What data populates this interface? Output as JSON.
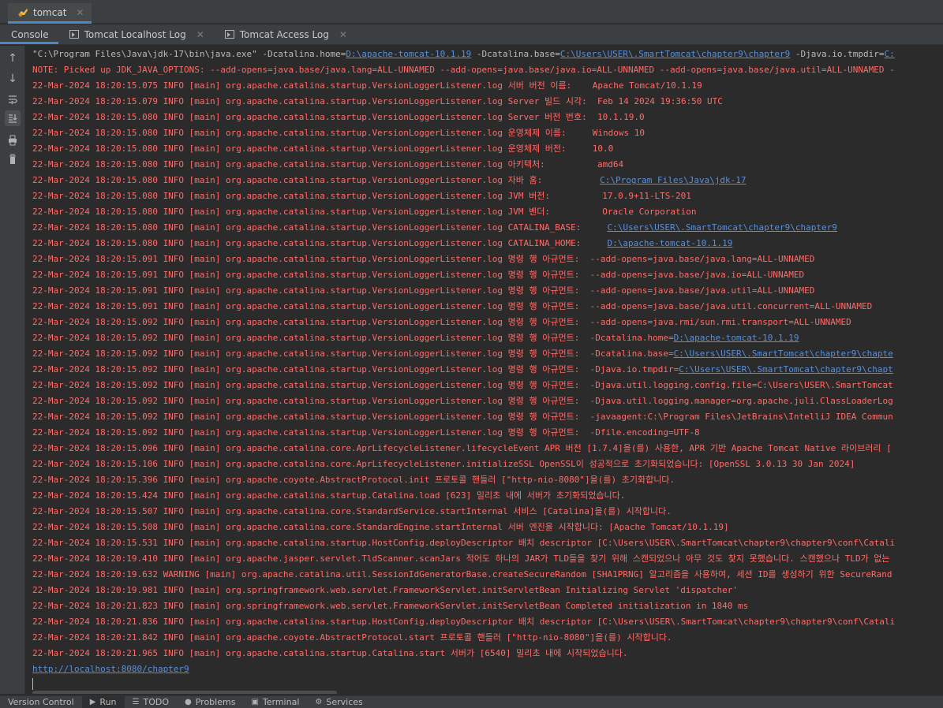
{
  "run_tab": {
    "label": "tomcat"
  },
  "sub_tabs": [
    {
      "label": "Console"
    },
    {
      "label": "Tomcat Localhost Log"
    },
    {
      "label": "Tomcat Access Log"
    }
  ],
  "console": {
    "command": {
      "pre": "\"C:\\Program Files\\Java\\jdk-17\\bin\\java.exe\" -Dcatalina.home=",
      "home": "D:\\apache-tomcat-10.1.19",
      "mid": " -Dcatalina.base=",
      "base": "C:\\Users\\USER\\.SmartTomcat\\chapter9\\chapter9",
      "post": " -Djava.io.tmpdir=",
      "tmp": "C:"
    },
    "lines": [
      "NOTE: Picked up JDK_JAVA_OPTIONS: --add-opens=java.base/java.lang=ALL-UNNAMED --add-opens=java.base/java.io=ALL-UNNAMED --add-opens=java.base/java.util=ALL-UNNAMED -",
      "22-Mar-2024 18:20:15.075 INFO [main] org.apache.catalina.startup.VersionLoggerListener.log 서버 버전 이름:    Apache Tomcat/10.1.19",
      "22-Mar-2024 18:20:15.079 INFO [main] org.apache.catalina.startup.VersionLoggerListener.log Server 빌드 시각:  Feb 14 2024 19:36:50 UTC",
      "22-Mar-2024 18:20:15.080 INFO [main] org.apache.catalina.startup.VersionLoggerListener.log Server 버전 번호:  10.1.19.0",
      "22-Mar-2024 18:20:15.080 INFO [main] org.apache.catalina.startup.VersionLoggerListener.log 운영체제 이름:     Windows 10",
      "22-Mar-2024 18:20:15.080 INFO [main] org.apache.catalina.startup.VersionLoggerListener.log 운영체제 버전:     10.0",
      "22-Mar-2024 18:20:15.080 INFO [main] org.apache.catalina.startup.VersionLoggerListener.log 아키텍처:          amd64"
    ],
    "java_home": {
      "pre": "22-Mar-2024 18:20:15.080 INFO [main] org.apache.catalina.startup.VersionLoggerListener.log 자바 홈:           ",
      "link": "C:\\Program Files\\Java\\jdk-17"
    },
    "lines2": [
      "22-Mar-2024 18:20:15.080 INFO [main] org.apache.catalina.startup.VersionLoggerListener.log JVM 버전:          17.0.9+11-LTS-201",
      "22-Mar-2024 18:20:15.080 INFO [main] org.apache.catalina.startup.VersionLoggerListener.log JVM 벤더:          Oracle Corporation"
    ],
    "cat_base": {
      "pre": "22-Mar-2024 18:20:15.080 INFO [main] org.apache.catalina.startup.VersionLoggerListener.log CATALINA_BASE:     ",
      "link": "C:\\Users\\USER\\.SmartTomcat\\chapter9\\chapter9"
    },
    "cat_home": {
      "pre": "22-Mar-2024 18:20:15.080 INFO [main] org.apache.catalina.startup.VersionLoggerListener.log CATALINA_HOME:     ",
      "link": "D:\\apache-tomcat-10.1.19"
    },
    "lines3": [
      "22-Mar-2024 18:20:15.091 INFO [main] org.apache.catalina.startup.VersionLoggerListener.log 명령 행 아규먼트:  --add-opens=java.base/java.lang=ALL-UNNAMED",
      "22-Mar-2024 18:20:15.091 INFO [main] org.apache.catalina.startup.VersionLoggerListener.log 명령 행 아규먼트:  --add-opens=java.base/java.io=ALL-UNNAMED",
      "22-Mar-2024 18:20:15.091 INFO [main] org.apache.catalina.startup.VersionLoggerListener.log 명령 행 아규먼트:  --add-opens=java.base/java.util=ALL-UNNAMED",
      "22-Mar-2024 18:20:15.091 INFO [main] org.apache.catalina.startup.VersionLoggerListener.log 명령 행 아규먼트:  --add-opens=java.base/java.util.concurrent=ALL-UNNAMED",
      "22-Mar-2024 18:20:15.092 INFO [main] org.apache.catalina.startup.VersionLoggerListener.log 명령 행 아규먼트:  --add-opens=java.rmi/sun.rmi.transport=ALL-UNNAMED"
    ],
    "arg_home": {
      "pre": "22-Mar-2024 18:20:15.092 INFO [main] org.apache.catalina.startup.VersionLoggerListener.log 명령 행 아규먼트:  -Dcatalina.home=",
      "link": "D:\\apache-tomcat-10.1.19"
    },
    "arg_base": {
      "pre": "22-Mar-2024 18:20:15.092 INFO [main] org.apache.catalina.startup.VersionLoggerListener.log 명령 행 아규먼트:  -Dcatalina.base=",
      "link": "C:\\Users\\USER\\.SmartTomcat\\chapter9\\chapte"
    },
    "arg_tmp": {
      "pre": "22-Mar-2024 18:20:15.092 INFO [main] org.apache.catalina.startup.VersionLoggerListener.log 명령 행 아규먼트:  -Djava.io.tmpdir=",
      "link": "C:\\Users\\USER\\.SmartTomcat\\chapter9\\chapt"
    },
    "lines4": [
      "22-Mar-2024 18:20:15.092 INFO [main] org.apache.catalina.startup.VersionLoggerListener.log 명령 행 아규먼트:  -Djava.util.logging.config.file=C:\\Users\\USER\\.SmartTomcat",
      "22-Mar-2024 18:20:15.092 INFO [main] org.apache.catalina.startup.VersionLoggerListener.log 명령 행 아규먼트:  -Djava.util.logging.manager=org.apache.juli.ClassLoaderLog",
      "22-Mar-2024 18:20:15.092 INFO [main] org.apache.catalina.startup.VersionLoggerListener.log 명령 행 아규먼트:  -javaagent:C:\\Program Files\\JetBrains\\IntelliJ IDEA Commun",
      "22-Mar-2024 18:20:15.092 INFO [main] org.apache.catalina.startup.VersionLoggerListener.log 명령 행 아규먼트:  -Dfile.encoding=UTF-8",
      "22-Mar-2024 18:20:15.096 INFO [main] org.apache.catalina.core.AprLifecycleListener.lifecycleEvent APR 버전 [1.7.4]을(를) 사용한, APR 기반 Apache Tomcat Native 라이브러리 [",
      "22-Mar-2024 18:20:15.106 INFO [main] org.apache.catalina.core.AprLifecycleListener.initializeSSL OpenSSL이 성공적으로 초기화되었습니다: [OpenSSL 3.0.13 30 Jan 2024]",
      "22-Mar-2024 18:20:15.396 INFO [main] org.apache.coyote.AbstractProtocol.init 프로토콜 핸들러 [\"http-nio-8080\"]을(를) 초기화합니다.",
      "22-Mar-2024 18:20:15.424 INFO [main] org.apache.catalina.startup.Catalina.load [623] 밀리초 내에 서버가 초기화되었습니다.",
      "22-Mar-2024 18:20:15.507 INFO [main] org.apache.catalina.core.StandardService.startInternal 서비스 [Catalina]을(를) 시작합니다.",
      "22-Mar-2024 18:20:15.508 INFO [main] org.apache.catalina.core.StandardEngine.startInternal 서버 엔진을 시작합니다: [Apache Tomcat/10.1.19]",
      "22-Mar-2024 18:20:15.531 INFO [main] org.apache.catalina.startup.HostConfig.deployDescriptor 배치 descriptor [C:\\Users\\USER\\.SmartTomcat\\chapter9\\chapter9\\conf\\Catali",
      "22-Mar-2024 18:20:19.410 INFO [main] org.apache.jasper.servlet.TldScanner.scanJars 적어도 하나의 JAR가 TLD들을 찾기 위해 스캔되었으나 아무 것도 찾지 못했습니다. 스캔했으나 TLD가 없는",
      "22-Mar-2024 18:20:19.632 WARNING [main] org.apache.catalina.util.SessionIdGeneratorBase.createSecureRandom [SHA1PRNG] 알고리즘을 사용하여, 세션 ID를 생성하기 위한 SecureRand",
      "22-Mar-2024 18:20:19.981 INFO [main] org.springframework.web.servlet.FrameworkServlet.initServletBean Initializing Servlet 'dispatcher'",
      "22-Mar-2024 18:20:21.823 INFO [main] org.springframework.web.servlet.FrameworkServlet.initServletBean Completed initialization in 1840 ms",
      "22-Mar-2024 18:20:21.836 INFO [main] org.apache.catalina.startup.HostConfig.deployDescriptor 배치 descriptor [C:\\Users\\USER\\.SmartTomcat\\chapter9\\chapter9\\conf\\Catali",
      "22-Mar-2024 18:20:21.842 INFO [main] org.apache.coyote.AbstractProtocol.start 프로토콜 핸들러 [\"http-nio-8080\"]을(를) 시작합니다.",
      "22-Mar-2024 18:20:21.965 INFO [main] org.apache.catalina.startup.Catalina.start 서버가 [6540] 밀리초 내에 시작되었습니다."
    ],
    "url": "http://localhost:8080/chapter9"
  },
  "bottom_tabs": [
    {
      "label": "Version Control",
      "icon": ""
    },
    {
      "label": "Run",
      "icon": "▶"
    },
    {
      "label": "TODO",
      "icon": "☰"
    },
    {
      "label": "Problems",
      "icon": "●"
    },
    {
      "label": "Terminal",
      "icon": "▣"
    },
    {
      "label": "Services",
      "icon": "⚙"
    }
  ],
  "colors": {
    "error_text": "#ff6b68",
    "link": "#5a8fd8",
    "accent": "#4a88c7"
  }
}
